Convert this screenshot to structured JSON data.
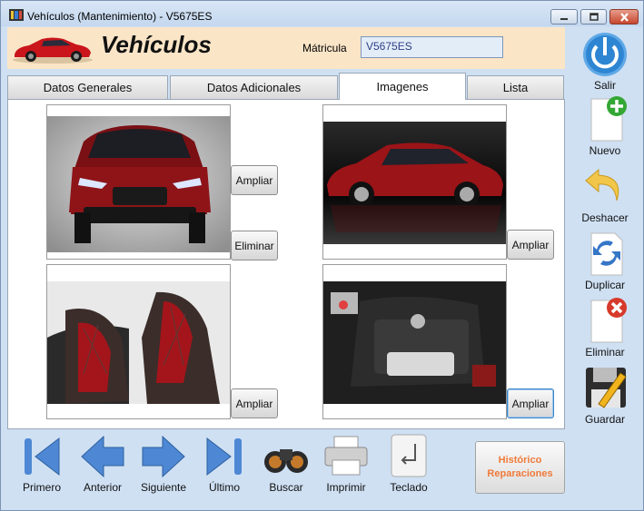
{
  "window": {
    "title": "Vehículos (Mantenimiento) - V5675ES",
    "icons": {
      "app": "film-strip-icon",
      "minimize": "minimize-icon",
      "maximize": "maximize-icon",
      "close": "close-icon"
    }
  },
  "header": {
    "title": "Vehículos",
    "logo_icon": "red-car-logo",
    "matricula_label": "Mátricula",
    "matricula_value": "V5675ES"
  },
  "tabs": [
    {
      "label": "Datos Generales",
      "active": false
    },
    {
      "label": "Datos Adicionales",
      "active": false
    },
    {
      "label": "Imagenes",
      "active": true
    },
    {
      "label": "Lista",
      "active": false
    }
  ],
  "images": [
    {
      "subject": "red-car-front-photo",
      "buttons": [
        "Ampliar",
        "Eliminar"
      ]
    },
    {
      "subject": "red-car-side-photo",
      "buttons": [
        "Ampliar"
      ]
    },
    {
      "subject": "car-interior-seats-photo",
      "buttons": [
        "Ampliar"
      ]
    },
    {
      "subject": "car-engine-photo",
      "buttons": [
        "Ampliar"
      ]
    }
  ],
  "sidebar": [
    {
      "label": "Salir",
      "icon": "power-icon"
    },
    {
      "label": "Nuevo",
      "icon": "new-document-icon"
    },
    {
      "label": "Deshacer",
      "icon": "undo-arrow-icon"
    },
    {
      "label": "Duplicar",
      "icon": "duplicate-icon"
    },
    {
      "label": "Eliminar",
      "icon": "delete-icon"
    },
    {
      "label": "Guardar",
      "icon": "save-floppy-icon"
    }
  ],
  "navbar": [
    {
      "label": "Primero",
      "icon": "first-record-icon"
    },
    {
      "label": "Anterior",
      "icon": "previous-arrow-icon"
    },
    {
      "label": "Siguiente",
      "icon": "next-arrow-icon"
    },
    {
      "label": "Último",
      "icon": "last-record-icon"
    },
    {
      "label": "Buscar",
      "icon": "binoculars-icon"
    },
    {
      "label": "Imprimir",
      "icon": "printer-icon"
    },
    {
      "label": "Teclado",
      "icon": "keyboard-enter-icon"
    }
  ],
  "historico_button": {
    "line1": "Histórico",
    "line2": "Reparaciones"
  },
  "colors": {
    "accent_orange": "#f07a3a",
    "header_bg": "#fbe5c7",
    "window_bg": "#cfe0f3",
    "car_red": "#8e1418"
  }
}
